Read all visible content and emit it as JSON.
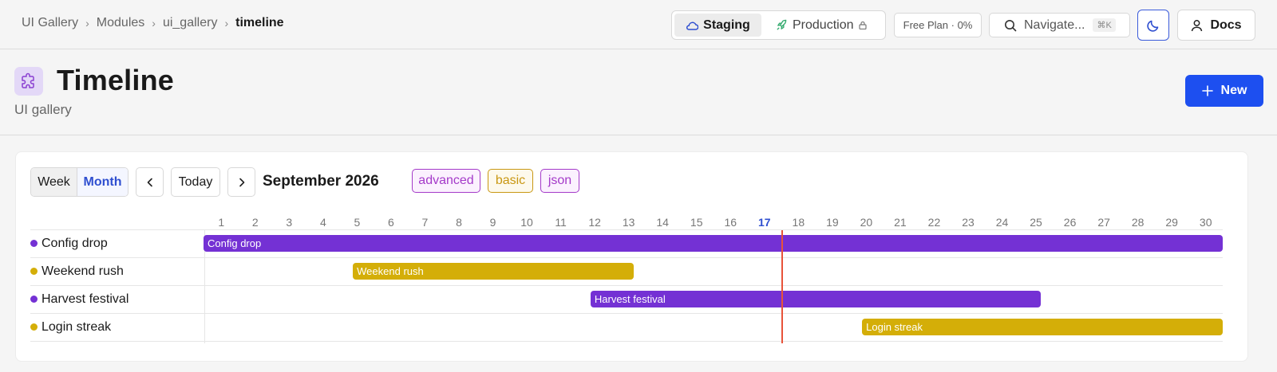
{
  "breadcrumb": [
    "UI Gallery",
    "Modules",
    "ui_gallery",
    "timeline"
  ],
  "environments": {
    "staging": "Staging",
    "production": "Production"
  },
  "plan": {
    "name": "Free Plan",
    "usage": "0%"
  },
  "search": {
    "label": "Navigate...",
    "shortcut": "⌘K"
  },
  "docs_label": "Docs",
  "page": {
    "title": "Timeline",
    "subtitle": "UI gallery",
    "new_label": "New"
  },
  "toolbar": {
    "week_label": "Week",
    "month_label": "Month",
    "today_label": "Today",
    "month_title": "September 2026",
    "view_mode": "Month"
  },
  "tags": [
    {
      "label": "advanced",
      "color": "#a43ac9",
      "bg": "#fbf1fe"
    },
    {
      "label": "basic",
      "color": "#c99712",
      "bg": "#fdf9ec"
    },
    {
      "label": "json",
      "color": "#a43ac9",
      "bg": "#fbf1fe"
    }
  ],
  "timeline": {
    "days_in_month": 30,
    "today": 17,
    "items": [
      {
        "label": "Config drop",
        "start": 1,
        "end": 30,
        "color": "#7431d4"
      },
      {
        "label": "Weekend rush",
        "start": 5,
        "end": 13,
        "color": "#d4ae08"
      },
      {
        "label": "Harvest festival",
        "start": 12,
        "end": 25,
        "color": "#7431d4"
      },
      {
        "label": "Login streak",
        "start": 20,
        "end": 30,
        "color": "#d4ae08"
      }
    ]
  }
}
